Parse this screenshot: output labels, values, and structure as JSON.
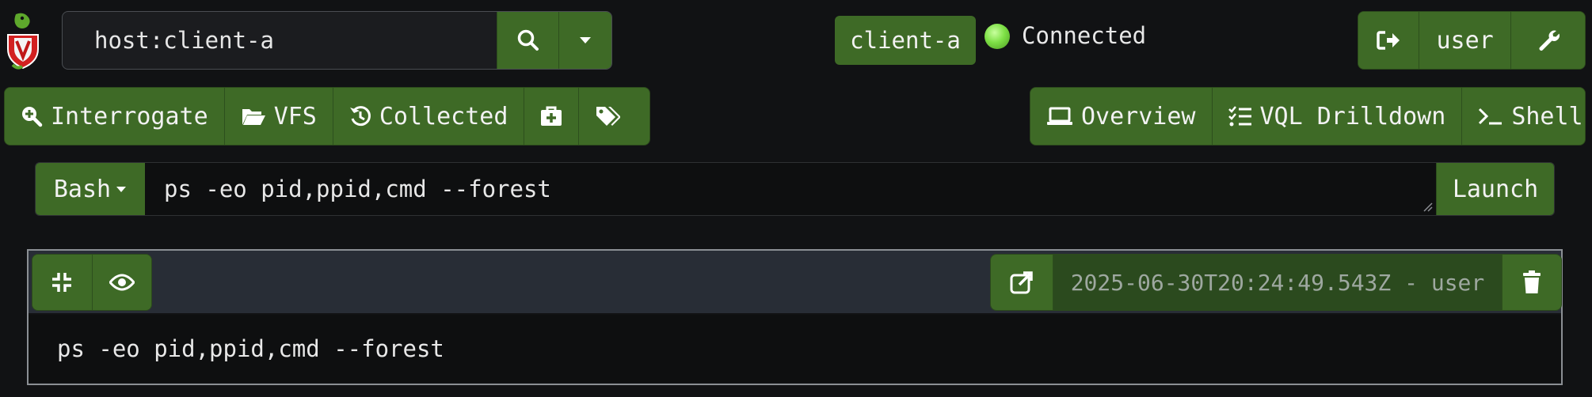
{
  "search": {
    "value": "host:client-a",
    "placeholder": ""
  },
  "client": {
    "name": "client-a",
    "status": "Connected"
  },
  "user_menu": {
    "username": "user"
  },
  "actions": [
    {
      "label": "Interrogate",
      "icon": "search-plus-icon"
    },
    {
      "label": "VFS",
      "icon": "folder-open-icon"
    },
    {
      "label": "Collected",
      "icon": "history-icon"
    },
    {
      "label": "",
      "icon": "medkit-icon"
    },
    {
      "label": "",
      "icon": "tags-icon"
    }
  ],
  "views": [
    {
      "label": "Overview",
      "icon": "laptop-icon"
    },
    {
      "label": "VQL Drilldown",
      "icon": "list-check-icon"
    },
    {
      "label": "Shell",
      "icon": "terminal-icon"
    }
  ],
  "shell": {
    "type": "Bash",
    "command": "ps -eo pid,ppid,cmd --forest",
    "launch_label": "Launch"
  },
  "result": {
    "timestamp_user": "2025-06-30T20:24:49.543Z - user",
    "command": "ps -eo pid,ppid,cmd --forest"
  },
  "colors": {
    "accent": "#3e6a26",
    "background": "#111214",
    "panel_header": "#282d36",
    "status_ok": "#7ee046"
  }
}
